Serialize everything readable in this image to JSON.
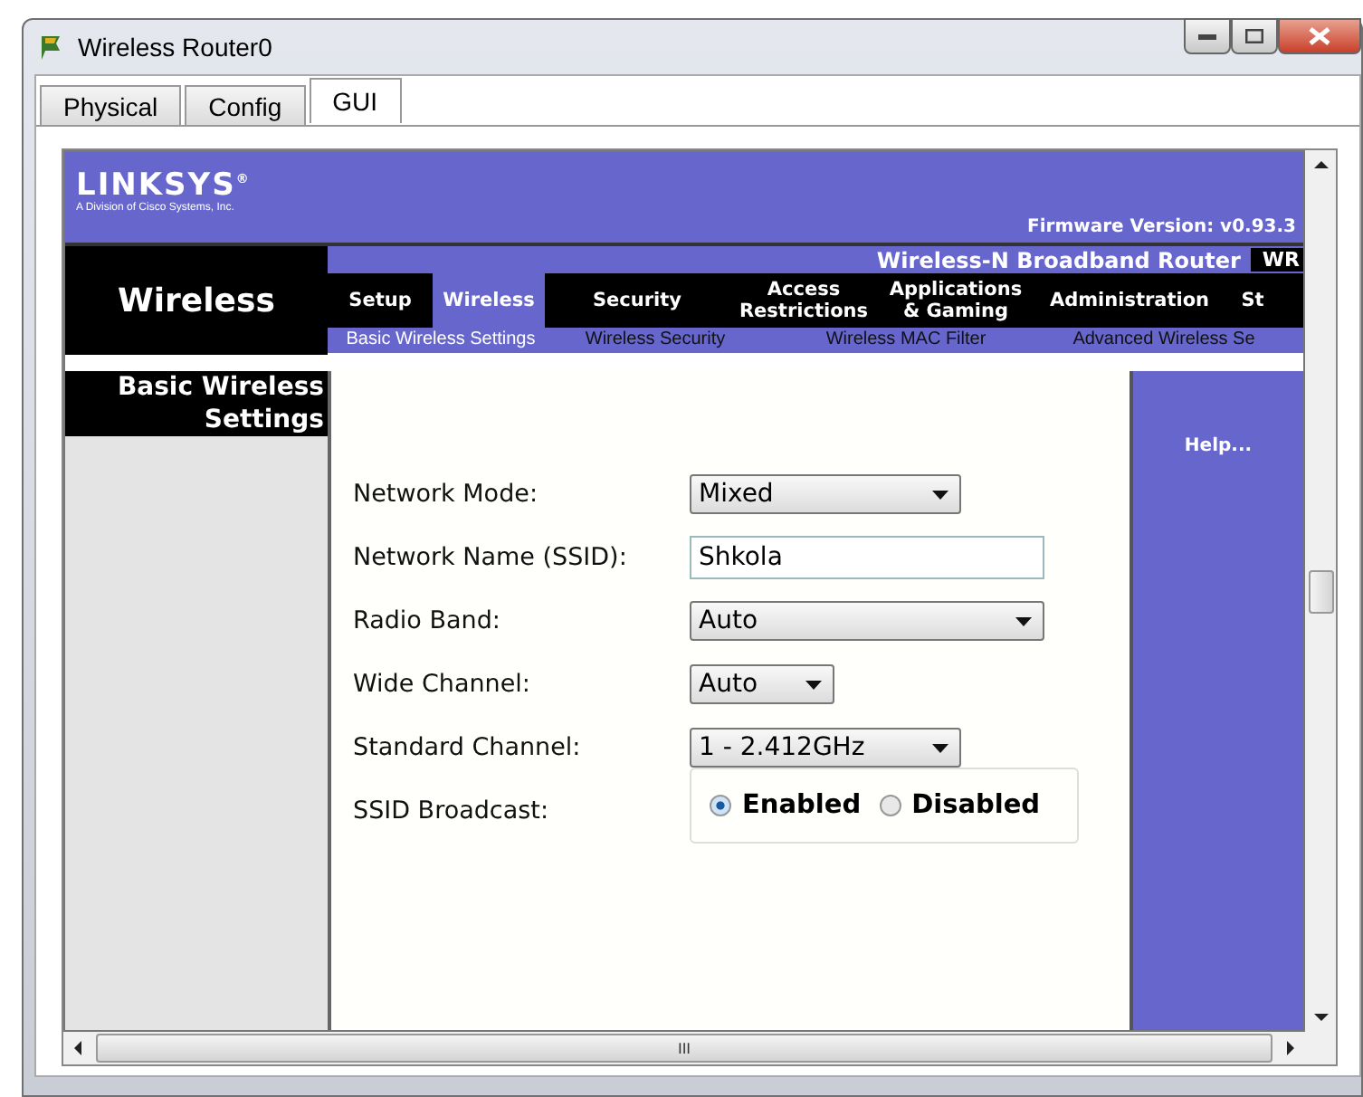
{
  "window": {
    "title": "Wireless Router0"
  },
  "tabs": [
    {
      "label": "Physical",
      "selected": false
    },
    {
      "label": "Config",
      "selected": false
    },
    {
      "label": "GUI",
      "selected": true
    }
  ],
  "header": {
    "logo": "LINKSYS",
    "logo_mark": "®",
    "tagline": "A Division of Cisco Systems, Inc.",
    "firmware": "Firmware Version: v0.93.3"
  },
  "product": {
    "name": "Wireless-N Broadband Router",
    "model": "WR"
  },
  "section": "Wireless",
  "nav": [
    {
      "label": "Setup",
      "selected": false
    },
    {
      "label": "Wireless",
      "selected": true
    },
    {
      "label": "Security",
      "selected": false
    },
    {
      "label": "Access Restrictions",
      "selected": false
    },
    {
      "label": "Applications & Gaming",
      "selected": false
    },
    {
      "label": "Administration",
      "selected": false
    },
    {
      "label": "St",
      "selected": false
    }
  ],
  "subnav": [
    {
      "label": "Basic Wireless Settings",
      "selected": true
    },
    {
      "label": "Wireless Security",
      "selected": false
    },
    {
      "label": "Wireless MAC Filter",
      "selected": false
    },
    {
      "label": "Advanced Wireless Se",
      "selected": false
    }
  ],
  "page_title": "Basic Wireless Settings",
  "help": "Help...",
  "fields": [
    {
      "kind": "select",
      "label": "Network Mode:",
      "value": "Mixed"
    },
    {
      "kind": "input",
      "label": "Network Name (SSID):",
      "value": "Shkola"
    },
    {
      "kind": "select",
      "label": "Radio Band:",
      "value": "Auto"
    },
    {
      "kind": "select",
      "label": "Wide Channel:",
      "value": "Auto"
    },
    {
      "kind": "select",
      "label": "Standard Channel:",
      "value": "1 - 2.412GHz"
    },
    {
      "kind": "radio",
      "label": "SSID Broadcast:",
      "options": [
        {
          "label": "Enabled",
          "selected": true
        },
        {
          "label": "Disabled",
          "selected": false
        }
      ]
    }
  ],
  "scrollbar": {
    "grip": "III"
  }
}
